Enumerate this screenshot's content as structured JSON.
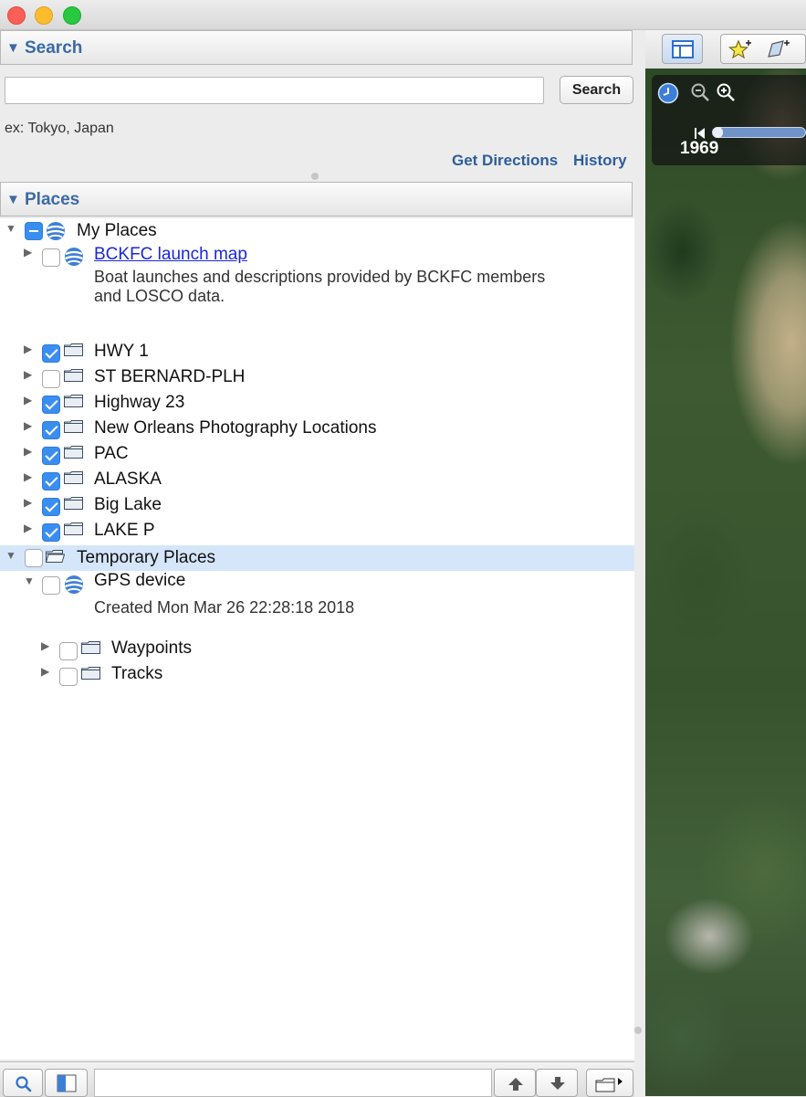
{
  "search": {
    "header": "Search",
    "input_value": "",
    "button_label": "Search",
    "hint": "ex: Tokyo, Japan",
    "get_directions": "Get Directions",
    "history": "History"
  },
  "places": {
    "header": "Places",
    "my_places": {
      "label": "My Places",
      "state": "mixed",
      "items": [
        {
          "label": "BCKFC launch map",
          "checked": false,
          "type": "network-link",
          "desc_line1": "Boat launches and descriptions provided by BCKFC members",
          "desc_line2": "and LOSCO data."
        },
        {
          "label": "HWY 1",
          "checked": true
        },
        {
          "label": "ST BERNARD-PLH",
          "checked": false
        },
        {
          "label": "Highway 23",
          "checked": true
        },
        {
          "label": "New Orleans Photography Locations",
          "checked": true
        },
        {
          "label": "PAC",
          "checked": true
        },
        {
          "label": "ALASKA",
          "checked": true
        },
        {
          "label": "Big Lake",
          "checked": true
        },
        {
          "label": "LAKE P",
          "checked": true
        }
      ]
    },
    "temporary_places": {
      "label": "Temporary Places",
      "checked": false,
      "gps_device": {
        "label": "GPS device",
        "created": "Created Mon Mar 26 22:28:18 2018",
        "children": [
          {
            "label": "Waypoints",
            "checked": false
          },
          {
            "label": "Tracks",
            "checked": false
          }
        ]
      }
    }
  },
  "map": {
    "year": "1969"
  },
  "colors": {
    "accent": "#3b6aa5",
    "checkbox_on": "#3a8ef2",
    "selection": "#d5e6fb",
    "link": "#1a27d6"
  }
}
